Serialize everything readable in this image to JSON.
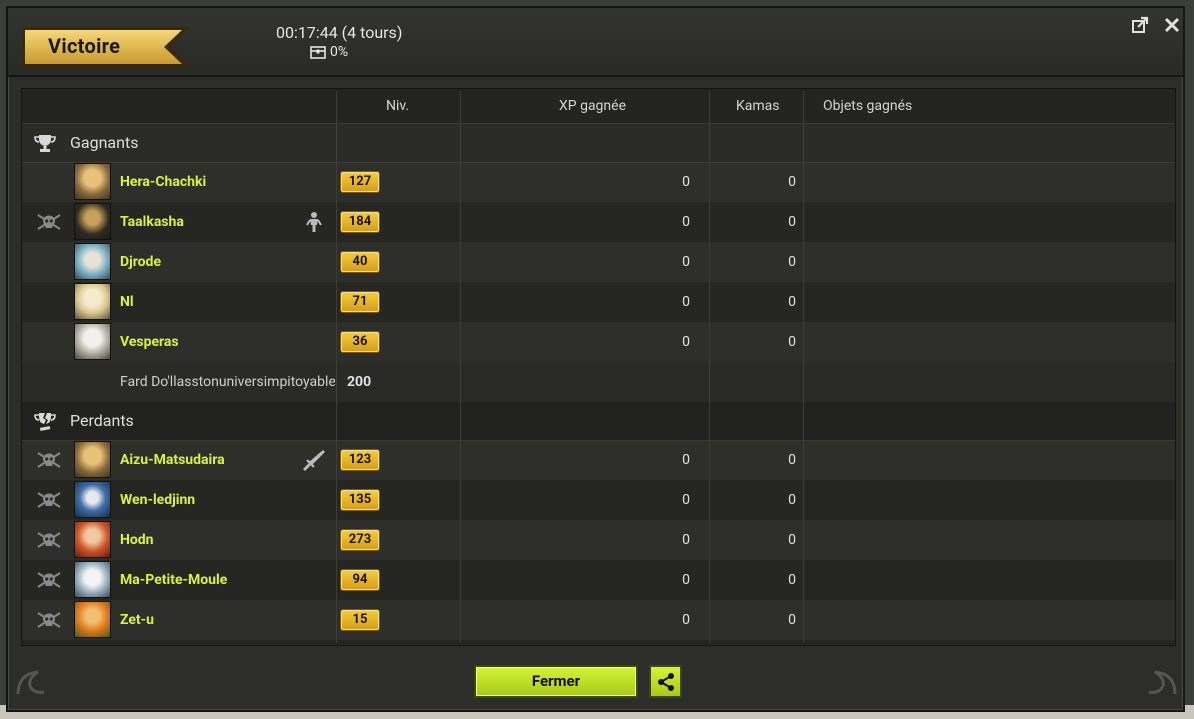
{
  "header": {
    "result": "Victoire",
    "duration": "00:17:44 (4 tours)",
    "chest_percent": "0%"
  },
  "columns": {
    "level": "Niv.",
    "xp": "XP gagnée",
    "kamas": "Kamas",
    "items": "Objets gagnés"
  },
  "winners": {
    "label": "Gagnants",
    "players": [
      {
        "name": "Hera-Chachki",
        "level": "127",
        "xp": "0",
        "kamas": "0"
      },
      {
        "name": "Taalkasha",
        "level": "184",
        "xp": "0",
        "kamas": "0"
      },
      {
        "name": "Djrode",
        "level": "40",
        "xp": "0",
        "kamas": "0"
      },
      {
        "name": "Nl",
        "level": "71",
        "xp": "0",
        "kamas": "0"
      },
      {
        "name": "Vesperas",
        "level": "36",
        "xp": "0",
        "kamas": "0"
      }
    ],
    "monster": {
      "name": "Fard Do'llasstonuniversimpitoyable",
      "level": "200"
    }
  },
  "losers": {
    "label": "Perdants",
    "players": [
      {
        "name": "Aizu-Matsudaira",
        "level": "123",
        "xp": "0",
        "kamas": "0"
      },
      {
        "name": "Wen-ledjinn",
        "level": "135",
        "xp": "0",
        "kamas": "0"
      },
      {
        "name": "Hodn",
        "level": "273",
        "xp": "0",
        "kamas": "0"
      },
      {
        "name": "Ma-Petite-Moule",
        "level": "94",
        "xp": "0",
        "kamas": "0"
      },
      {
        "name": "Zet-u",
        "level": "15",
        "xp": "0",
        "kamas": "0"
      }
    ]
  },
  "footer": {
    "close_label": "Fermer"
  },
  "icons": {
    "popout": "popout-icon",
    "close": "close-icon",
    "trophy": "trophy-icon",
    "broken_trophy": "broken-trophy-icon",
    "skull": "skull-icon",
    "character": "character-icon",
    "sword": "sword-icon",
    "share": "share-icon",
    "chest": "chest-icon"
  },
  "colors": {
    "player_name": "#d6f53a",
    "level_badge": "#e8b62a",
    "button": "#c4e22a"
  }
}
